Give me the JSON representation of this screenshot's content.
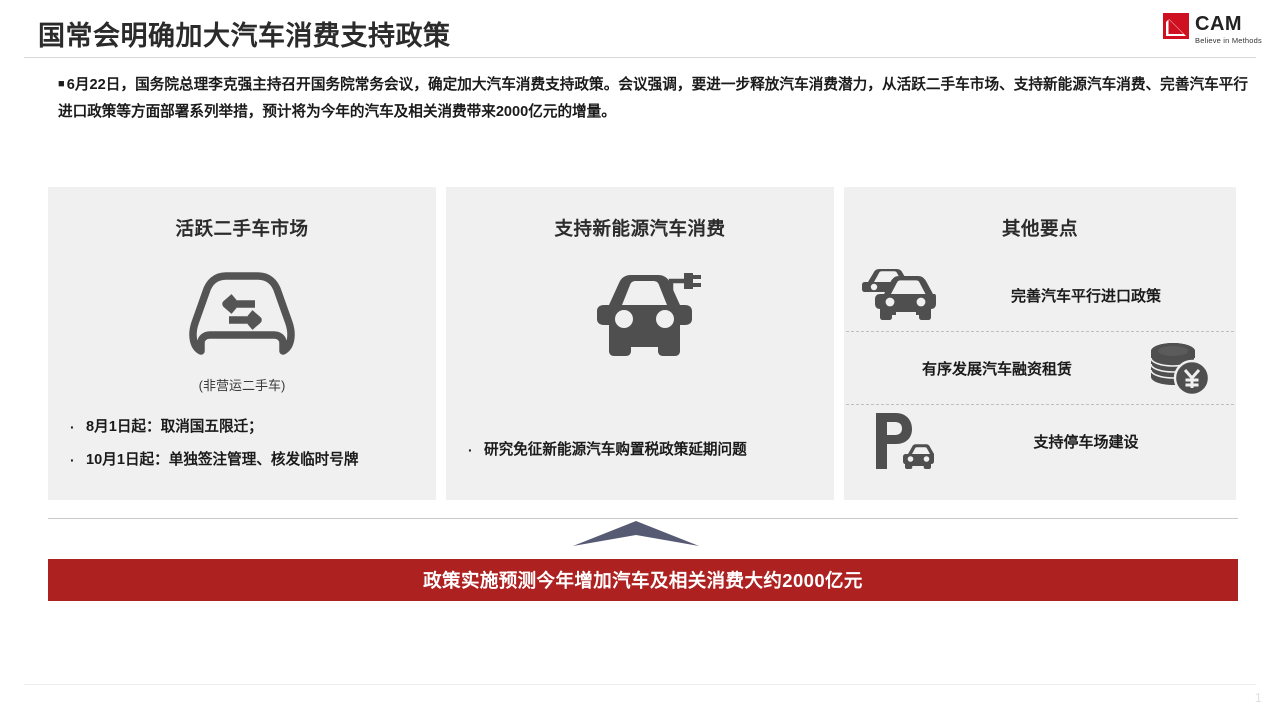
{
  "header": {
    "title": "国常会明确加大汽车消费支持政策",
    "logo": {
      "name": "CAM",
      "tagline": "Believe in Methods",
      "mark": "cam-red-square-logo"
    }
  },
  "summary": {
    "bullet_marker": "■",
    "text": "6月22日，国务院总理李克强主持召开国务院常务会议，确定加大汽车消费支持政策。会议强调，要进一步释放汽车消费潜力，从活跃二手车市场、支持新能源汽车消费、完善汽车平行进口政策等方面部署系列举措，预计将为今年的汽车及相关消费带来2000亿元的增量。"
  },
  "panels": [
    {
      "id": "used-car-market",
      "title": "活跃二手车市场",
      "icon": "car-swap-icon",
      "icon_caption": "(非营运二手车)",
      "bullets": [
        {
          "marker": "·",
          "text": "8月1日起：取消国五限迁；"
        },
        {
          "marker": "·",
          "text": "10月1日起：单独签注管理、核发临时号牌"
        }
      ]
    },
    {
      "id": "new-energy-vehicle",
      "title": "支持新能源汽车消费",
      "icon": "electric-car-charging-icon",
      "bullets": [
        {
          "marker": "·",
          "text": "研究免征新能源汽车购置税政策延期问题"
        }
      ]
    },
    {
      "id": "other-key-points",
      "title": "其他要点",
      "rows": [
        {
          "icon": "two-cars-icon",
          "icon_side": "left",
          "text": "完善汽车平行进口政策"
        },
        {
          "icon": "coin-stack-yuan-icon",
          "icon_side": "right",
          "text": "有序发展汽车融资租赁"
        },
        {
          "icon": "parking-car-icon",
          "icon_side": "left",
          "text": "支持停车场建设"
        }
      ]
    }
  ],
  "arrow": {
    "name": "up-arrow-connector",
    "color": "#565a73"
  },
  "banner": {
    "text": "政策实施预测今年增加汽车及相关消费大约2000亿元",
    "background": "#ae2121",
    "color": "#ffffff"
  },
  "footer": {
    "page_number": "1"
  },
  "colors": {
    "panel_bg": "#f0f0f0",
    "title": "#2b2b2b",
    "icon_gray": "#4f4f4f",
    "banner_red": "#ae2121",
    "logo_red": "#cf1020"
  }
}
